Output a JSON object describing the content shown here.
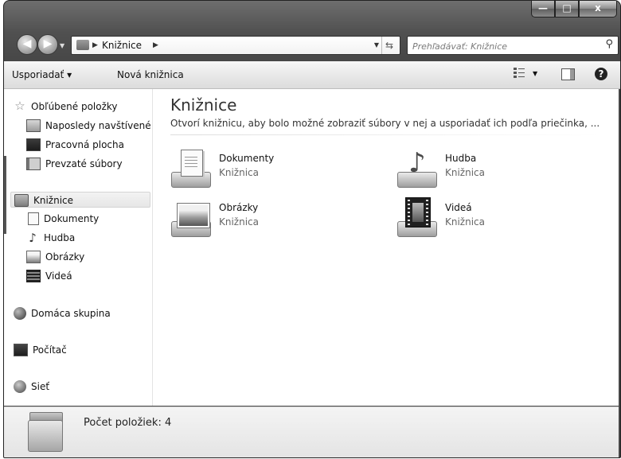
{
  "window": {
    "buttons": {
      "minimize": "—",
      "maximize": "□",
      "close": "x"
    }
  },
  "navigation": {
    "address_crumb": "Knižnice",
    "search_placeholder": "Prehľadávať: Knižnice"
  },
  "toolbar": {
    "organize_label": "Usporiadať ▾",
    "new_library_label": "Nová knižnica",
    "help_label": "?"
  },
  "sidebar": {
    "favorites": {
      "label": "Obľúbené položky",
      "items": [
        "Naposledy navštívené",
        "Pracovná plocha",
        "Prevzaté súbory"
      ]
    },
    "libraries": {
      "label": "Knižnice",
      "items": [
        "Dokumenty",
        "Hudba",
        "Obrázky",
        "Videá"
      ]
    },
    "homegroup": "Domáca skupina",
    "computer": "Počítač",
    "network": "Sieť"
  },
  "main": {
    "title": "Knižnice",
    "description": "Otvorí knižnicu, aby bolo možné zobraziť súbory v nej a usporiadať ich podľa priečinka, ...",
    "libraries": [
      {
        "name": "Dokumenty",
        "type": "Knižnica",
        "icon": "documents-library-icon"
      },
      {
        "name": "Hudba",
        "type": "Knižnica",
        "icon": "music-library-icon"
      },
      {
        "name": "Obrázky",
        "type": "Knižnica",
        "icon": "pictures-library-icon"
      },
      {
        "name": "Videá",
        "type": "Knižnica",
        "icon": "videos-library-icon"
      }
    ]
  },
  "status": {
    "item_count": "Počet položiek: 4"
  }
}
